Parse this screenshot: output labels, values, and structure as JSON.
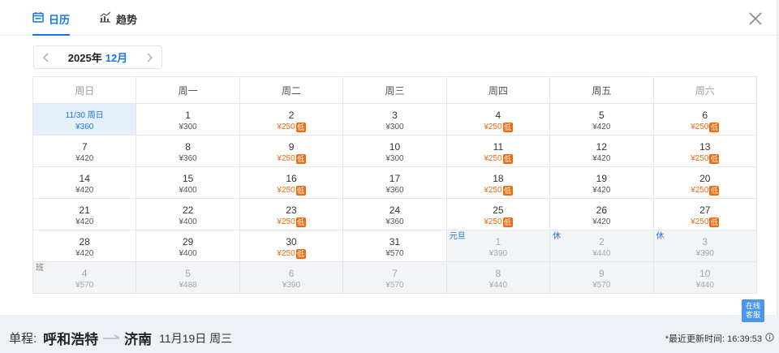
{
  "tabs": [
    {
      "label": "日历",
      "icon": "calendar-icon",
      "active": true
    },
    {
      "label": "趋势",
      "icon": "trend-chart-icon",
      "active": false
    }
  ],
  "month_switch": {
    "year_label": "2025年",
    "month_label": "12月"
  },
  "weekdays": [
    "周日",
    "周一",
    "周二",
    "周三",
    "周四",
    "周五",
    "周六"
  ],
  "low_badge": "低",
  "weeks": [
    [
      {
        "day": "11/30 周日",
        "price": "¥360",
        "selected": true
      },
      {
        "day": "1",
        "price": "¥300"
      },
      {
        "day": "2",
        "price": "¥250",
        "low": true
      },
      {
        "day": "3",
        "price": "¥300"
      },
      {
        "day": "4",
        "price": "¥250",
        "low": true
      },
      {
        "day": "5",
        "price": "¥420"
      },
      {
        "day": "6",
        "price": "¥250",
        "low": true
      }
    ],
    [
      {
        "day": "7",
        "price": "¥420"
      },
      {
        "day": "8",
        "price": "¥360"
      },
      {
        "day": "9",
        "price": "¥250",
        "low": true
      },
      {
        "day": "10",
        "price": "¥300"
      },
      {
        "day": "11",
        "price": "¥250",
        "low": true
      },
      {
        "day": "12",
        "price": "¥420"
      },
      {
        "day": "13",
        "price": "¥250",
        "low": true
      }
    ],
    [
      {
        "day": "14",
        "price": "¥420"
      },
      {
        "day": "15",
        "price": "¥400"
      },
      {
        "day": "16",
        "price": "¥250",
        "low": true
      },
      {
        "day": "17",
        "price": "¥360"
      },
      {
        "day": "18",
        "price": "¥250",
        "low": true
      },
      {
        "day": "19",
        "price": "¥420"
      },
      {
        "day": "20",
        "price": "¥250",
        "low": true
      }
    ],
    [
      {
        "day": "21",
        "price": "¥420"
      },
      {
        "day": "22",
        "price": "¥400"
      },
      {
        "day": "23",
        "price": "¥250",
        "low": true
      },
      {
        "day": "24",
        "price": "¥360"
      },
      {
        "day": "25",
        "price": "¥250",
        "low": true
      },
      {
        "day": "26",
        "price": "¥420"
      },
      {
        "day": "27",
        "price": "¥250",
        "low": true
      }
    ],
    [
      {
        "day": "28",
        "price": "¥420"
      },
      {
        "day": "29",
        "price": "¥400"
      },
      {
        "day": "30",
        "price": "¥250",
        "low": true
      },
      {
        "day": "31",
        "price": "¥570"
      },
      {
        "day": "1",
        "price": "¥390",
        "next": true,
        "tag": "元旦",
        "tag_type": "hol"
      },
      {
        "day": "2",
        "price": "¥440",
        "next": true,
        "tag": "休",
        "tag_type": "hol"
      },
      {
        "day": "3",
        "price": "¥390",
        "next": true,
        "tag": "休",
        "tag_type": "hol"
      }
    ],
    [
      {
        "day": "4",
        "price": "¥570",
        "next": true,
        "tag": "班",
        "tag_type": "work"
      },
      {
        "day": "5",
        "price": "¥488",
        "next": true
      },
      {
        "day": "6",
        "price": "¥390",
        "next": true
      },
      {
        "day": "7",
        "price": "¥570",
        "next": true
      },
      {
        "day": "8",
        "price": "¥440",
        "next": true
      },
      {
        "day": "9",
        "price": "¥570",
        "next": true
      },
      {
        "day": "10",
        "price": "¥440",
        "next": true
      }
    ]
  ],
  "customer_service": {
    "line1": "在线",
    "line2": "客服"
  },
  "trip": {
    "type_label": "单程:",
    "from": "呼和浩特",
    "to": "济南",
    "date": "11月19日 周三"
  },
  "update": {
    "text": "*最近更新时间: 16:39:53"
  },
  "colors": {
    "accent": "#1677e6",
    "low_price": "#f26a10"
  }
}
